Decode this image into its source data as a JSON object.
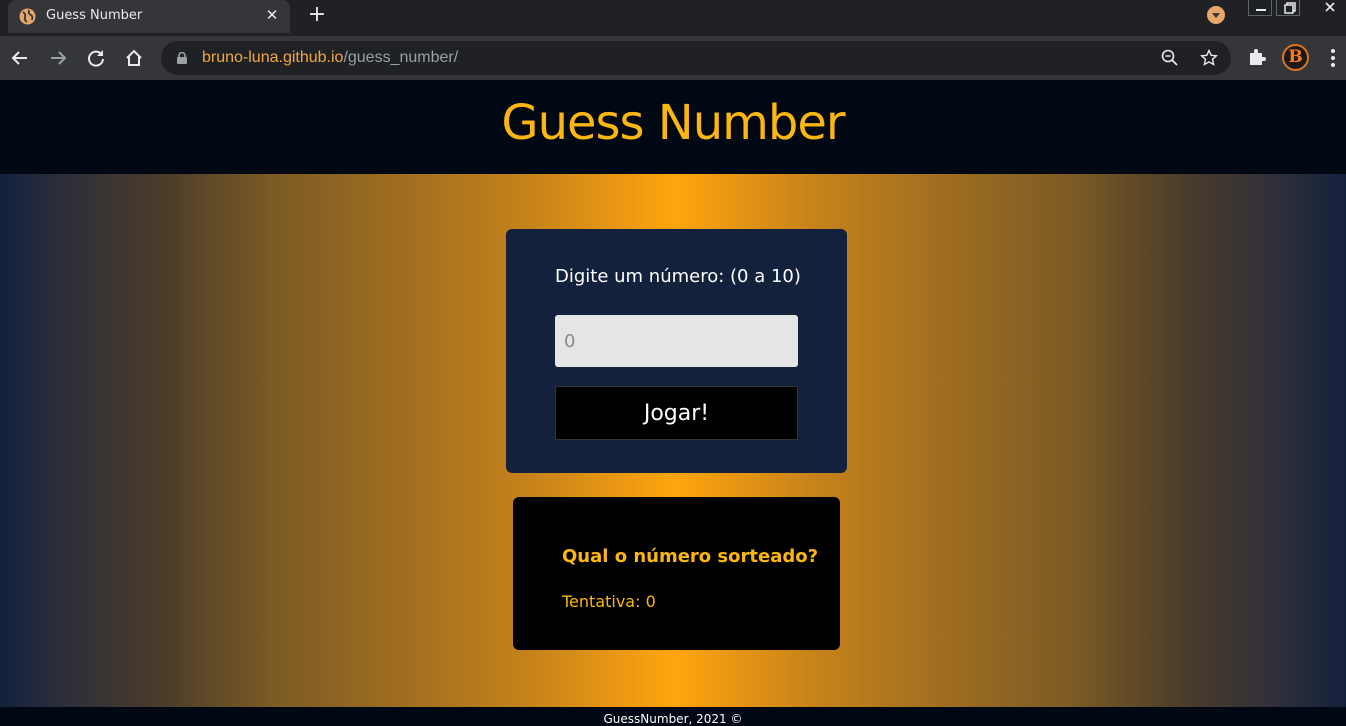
{
  "browser": {
    "tab_title": "Guess Number",
    "tab_close": "✕",
    "new_tab": "+",
    "url_host": "bruno-luna.github.io",
    "url_path": "/guess_number/",
    "profile_letter": "B",
    "accent_color": "#f0a840"
  },
  "page": {
    "title": "Guess Number",
    "input_label": "Digite um número: (0 a 10)",
    "input_placeholder": "0",
    "play_button": "Jogar!",
    "result_question": "Qual o número sorteado?",
    "attempt_text": "Tentativa: 0",
    "footer": "GuessNumber,  2021 ©",
    "colors": {
      "header_bg": "#000814",
      "title": "#fcb60f",
      "card_bg": "#14213d",
      "gradient_center": "#ffa50e"
    }
  },
  "icons": {
    "favicon": "globe-icon",
    "back": "arrow-left-icon",
    "forward": "arrow-right-icon",
    "reload": "reload-icon",
    "home": "home-icon",
    "lock": "lock-icon",
    "zoom": "zoom-out-icon",
    "bookmark": "star-icon",
    "extensions": "puzzle-icon",
    "menu": "kebab-menu-icon"
  }
}
